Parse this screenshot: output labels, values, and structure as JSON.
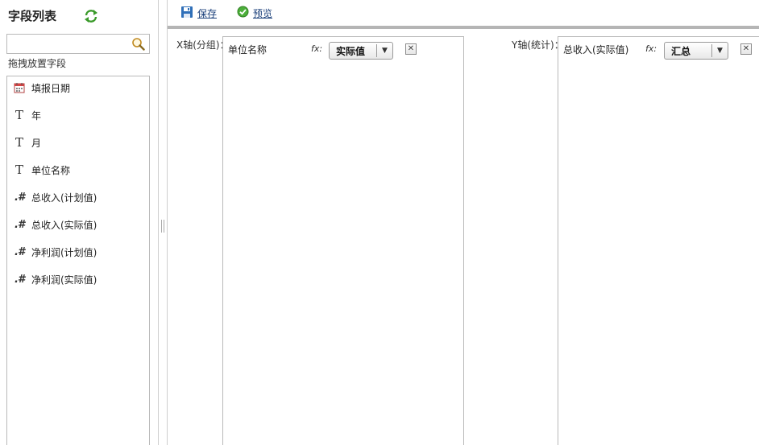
{
  "left_panel": {
    "title": "字段列表",
    "search": {
      "value": "",
      "placeholder": ""
    },
    "drag_hint": "拖拽放置字段",
    "fields": [
      {
        "icon": "calendar-icon",
        "type_glyph": "",
        "label": "填报日期"
      },
      {
        "icon": "text-type-icon",
        "type_glyph": "T",
        "label": "年"
      },
      {
        "icon": "text-type-icon",
        "type_glyph": "T",
        "label": "月"
      },
      {
        "icon": "text-type-icon",
        "type_glyph": "T",
        "label": "单位名称"
      },
      {
        "icon": "number-type-icon",
        "type_glyph": ".#",
        "label": "总收入(计划值)"
      },
      {
        "icon": "number-type-icon",
        "type_glyph": ".#",
        "label": "总收入(实际值)"
      },
      {
        "icon": "number-type-icon",
        "type_glyph": ".#",
        "label": "净利润(计划值)"
      },
      {
        "icon": "number-type-icon",
        "type_glyph": ".#",
        "label": "净利润(实际值)"
      }
    ]
  },
  "toolbar": {
    "save_label": "保存",
    "preview_label": "预览"
  },
  "x_axis": {
    "label": "X轴(分组)：",
    "field_name": "单位名称",
    "fx": "fx:",
    "mode_value": "实际值"
  },
  "y_axis": {
    "label": "Y轴(统计)：",
    "field_name": "总收入(实际值)",
    "fx": "fx:",
    "mode_value": "汇总"
  },
  "colors": {
    "border": "#b9b9b9",
    "link": "#1a3f7a",
    "refresh_green": "#3a9a2a",
    "preview_green": "#4caf3a",
    "save_blue": "#2f6fb8"
  }
}
